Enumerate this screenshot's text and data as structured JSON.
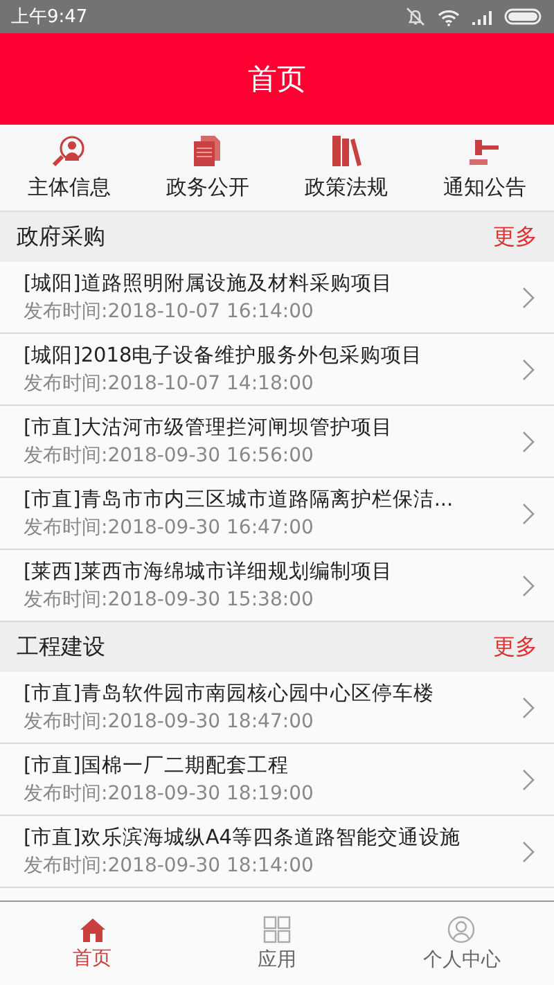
{
  "status_bar": {
    "time": "上午9:47"
  },
  "header": {
    "title": "首页"
  },
  "shortcuts": [
    {
      "label": "主体信息",
      "kind": "search"
    },
    {
      "label": "政务公开",
      "kind": "docs"
    },
    {
      "label": "政策法规",
      "kind": "books"
    },
    {
      "label": "通知公告",
      "kind": "gavel"
    }
  ],
  "sections": [
    {
      "title": "政府采购",
      "more": "更多",
      "items": [
        {
          "title": "[城阳]道路照明附属设施及材料采购项目",
          "time": "发布时间:2018-10-07 16:14:00"
        },
        {
          "title": "[城阳]2018电子设备维护服务外包采购项目",
          "time": "发布时间:2018-10-07 14:18:00"
        },
        {
          "title": "[市直]大沽河市级管理拦河闸坝管护项目",
          "time": "发布时间:2018-09-30 16:56:00"
        },
        {
          "title": "[市直]青岛市市内三区城市道路隔离护栏保洁...",
          "time": "发布时间:2018-09-30 16:47:00"
        },
        {
          "title": "[莱西]莱西市海绵城市详细规划编制项目",
          "time": "发布时间:2018-09-30 15:38:00"
        }
      ]
    },
    {
      "title": "工程建设",
      "more": "更多",
      "items": [
        {
          "title": "[市直]青岛软件园市南园核心园中心区停车楼",
          "time": "发布时间:2018-09-30 18:47:00"
        },
        {
          "title": "[市直]国棉一厂二期配套工程",
          "time": "发布时间:2018-09-30 18:19:00"
        },
        {
          "title": "[市直]欢乐滨海城纵A4等四条道路智能交通设施",
          "time": "发布时间:2018-09-30 18:14:00"
        }
      ]
    }
  ],
  "tab_bar": [
    {
      "label": "首页",
      "kind": "home",
      "selected": true
    },
    {
      "label": "应用",
      "kind": "grid",
      "selected": false
    },
    {
      "label": "个人中心",
      "kind": "person",
      "selected": false
    }
  ]
}
